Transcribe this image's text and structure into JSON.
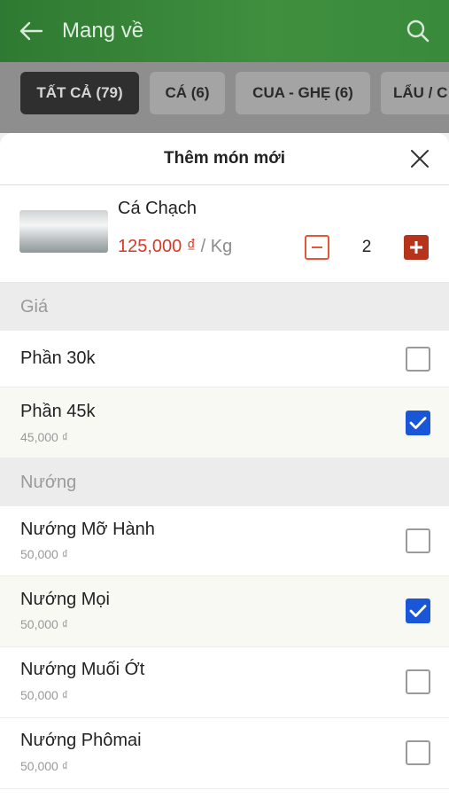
{
  "app": {
    "title": "Mang về"
  },
  "tabs": [
    {
      "label": "TẤT CẢ (79)",
      "active": true
    },
    {
      "label": "CÁ (6)",
      "active": false
    },
    {
      "label": "CUA - GHẸ (6)",
      "active": false
    },
    {
      "label": "LẨU / C",
      "active": false
    }
  ],
  "sheet": {
    "title": "Thêm món mới",
    "product": {
      "name": "Cá Chạch",
      "price": "125,000 ₫",
      "unit_sep": " / ",
      "unit": "Kg",
      "quantity": "2"
    },
    "sections": [
      {
        "title": "Giá",
        "options": [
          {
            "name": "Phần 30k",
            "price": "",
            "checked": false
          },
          {
            "name": "Phần 45k",
            "price": "45,000 ₫",
            "checked": true
          }
        ]
      },
      {
        "title": "Nướng",
        "options": [
          {
            "name": "Nướng Mỡ Hành",
            "price": "50,000 ₫",
            "checked": false
          },
          {
            "name": "Nướng Mọi",
            "price": "50,000 ₫",
            "checked": true
          },
          {
            "name": "Nướng Muối Ớt",
            "price": "50,000 ₫",
            "checked": false
          },
          {
            "name": "Nướng Phômai",
            "price": "50,000 ₫",
            "checked": false
          }
        ]
      }
    ]
  },
  "colors": {
    "header_green": "#3a8a3c",
    "price_red": "#d33b27",
    "checkbox_blue": "#1a56d8",
    "plus_red": "#b7341c"
  }
}
